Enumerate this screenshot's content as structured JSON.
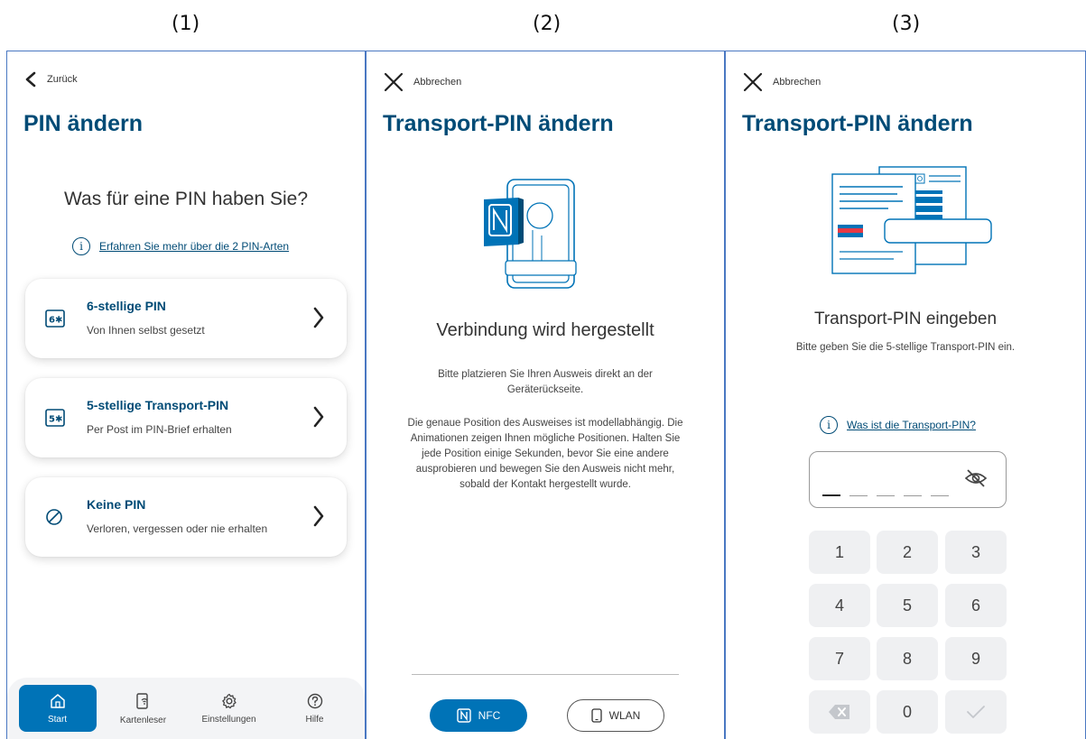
{
  "steps": [
    "(1)",
    "(2)",
    "(3)"
  ],
  "screen1": {
    "back_label": "Zurück",
    "title": "PIN ändern",
    "question": "Was für eine PIN haben Sie?",
    "info_link": "Erfahren Sie mehr über die 2 PIN-Arten",
    "options": [
      {
        "title": "6-stellige PIN",
        "subtitle": "Von Ihnen selbst gesetzt",
        "icon": "6✱"
      },
      {
        "title": "5-stellige Transport-PIN",
        "subtitle": "Per Post im PIN-Brief erhalten",
        "icon": "5✱"
      },
      {
        "title": "Keine PIN",
        "subtitle": "Verloren, vergessen oder nie erhalten",
        "icon": "⊘"
      }
    ],
    "nav": [
      {
        "label": "Start",
        "icon": "home-icon"
      },
      {
        "label": "Kartenleser",
        "icon": "card-reader-icon"
      },
      {
        "label": "Einstellungen",
        "icon": "gear-icon"
      },
      {
        "label": "Hilfe",
        "icon": "help-icon"
      }
    ]
  },
  "screen2": {
    "cancel_label": "Abbrechen",
    "title": "Transport-PIN ändern",
    "status": "Verbindung wird hergestellt",
    "para1_line1": "Bitte platzieren Sie Ihren Ausweis direkt an der",
    "para1_line2": "Geräterückseite.",
    "para2_line1": "Die genaue Position des Ausweises ist modellabhängig. Die",
    "para2_line2": "Animationen zeigen Ihnen mögliche Positionen. Halten Sie",
    "para2_line3": "jede Position einige Sekunden, bevor Sie eine andere",
    "para2_line4": "ausprobieren und bewegen Sie den Ausweis nicht mehr,",
    "para2_line5": "sobald der Kontakt hergestellt wurde.",
    "nfc_label": "NFC",
    "wlan_label": "WLAN"
  },
  "screen3": {
    "cancel_label": "Abbrechen",
    "title": "Transport-PIN ändern",
    "heading": "Transport-PIN eingeben",
    "subtitle": "Bitte geben Sie die 5-stellige Transport-PIN ein.",
    "info_link": "Was ist die Transport-PIN?",
    "keys": [
      "1",
      "2",
      "3",
      "4",
      "5",
      "6",
      "7",
      "8",
      "9",
      "0"
    ]
  },
  "colors": {
    "brand": "#004b76",
    "accent": "#0073b7",
    "frame": "#4a78c2"
  }
}
